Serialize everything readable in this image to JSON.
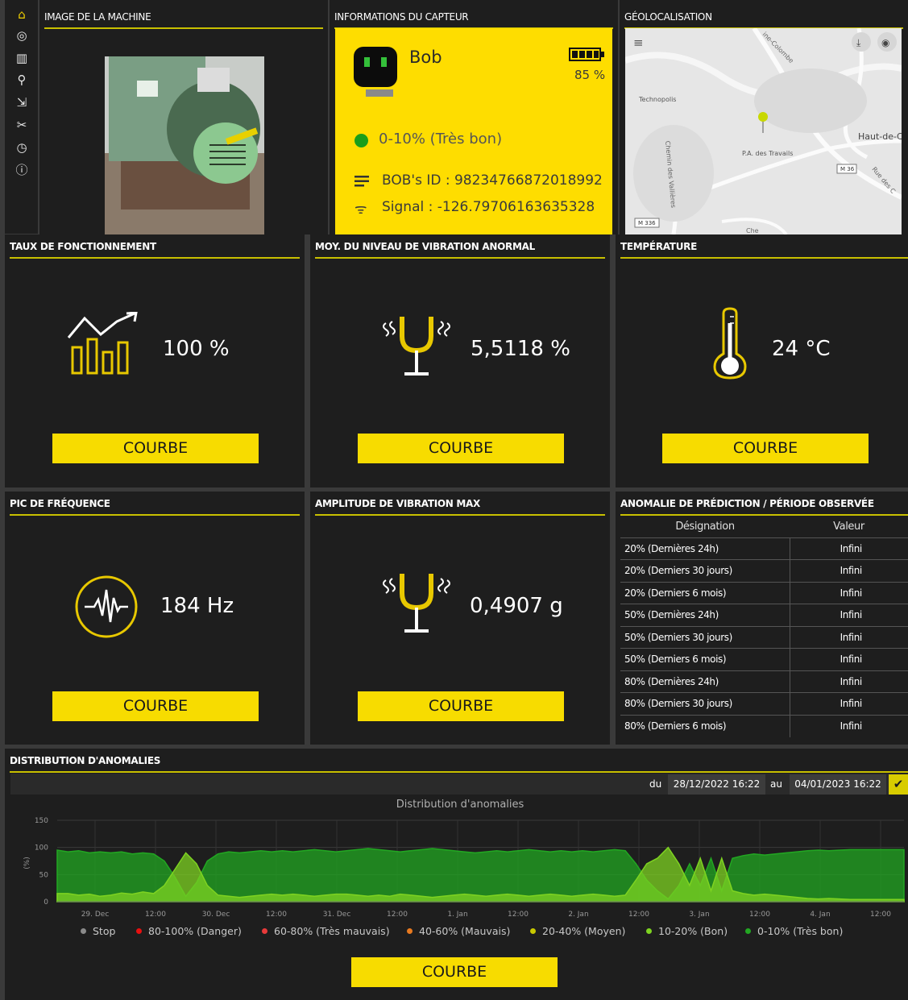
{
  "sidebar": {
    "icons": [
      "home-icon",
      "dashboard-icon",
      "analytics-icon",
      "search-icon",
      "export-icon",
      "tools-icon",
      "history-icon",
      "info-icon"
    ]
  },
  "machine_image": {
    "title": "IMAGE DE LA MACHINE"
  },
  "sensor_info": {
    "title": "INFORMATIONS DU CAPTEUR",
    "name": "Bob",
    "battery": "85 %",
    "status": "0-10% (Très bon)",
    "bob_id": "BOB's ID : 98234766872018992",
    "signal": "Signal : -126.79706163635328",
    "status_color": "#1a9e1a"
  },
  "geoloc": {
    "title": "GÉOLOCALISATION",
    "labels": {
      "technopolis": "Technopolis",
      "pa": "P.A. des Travails",
      "haut": "Haut-de-C",
      "colombe": "ine-Colombe",
      "chemin": "Chemin des Vallières",
      "rue": "Rue des C",
      "m36": "M 36",
      "m336": "M 336",
      "che": "Che"
    }
  },
  "metrics": {
    "taux": {
      "title": "TAUX DE FONCTIONNEMENT",
      "value": "100 %",
      "button": "COURBE"
    },
    "moy": {
      "title": "MOY. DU NIVEAU DE VIBRATION ANORMAL",
      "value": "5,5118 %",
      "button": "COURBE"
    },
    "temp": {
      "title": "TEMPÉRATURE",
      "value": "24 °C",
      "button": "COURBE"
    },
    "pic": {
      "title": "PIC DE FRÉQUENCE",
      "value": "184 Hz",
      "button": "COURBE"
    },
    "amp": {
      "title": "AMPLITUDE DE VIBRATION MAX",
      "value": "0,4907 g",
      "button": "COURBE"
    }
  },
  "anomaly_table": {
    "title": "ANOMALIE DE PRÉDICTION / PÉRIODE OBSERVÉE",
    "headers": [
      "Désignation",
      "Valeur"
    ],
    "rows": [
      [
        "20% (Dernières 24h)",
        "Infini"
      ],
      [
        "20% (Derniers 30 jours)",
        "Infini"
      ],
      [
        "20% (Derniers 6 mois)",
        "Infini"
      ],
      [
        "50% (Dernières 24h)",
        "Infini"
      ],
      [
        "50% (Derniers 30 jours)",
        "Infini"
      ],
      [
        "50% (Derniers 6 mois)",
        "Infini"
      ],
      [
        "80% (Dernières 24h)",
        "Infini"
      ],
      [
        "80% (Derniers 30 jours)",
        "Infini"
      ],
      [
        "80% (Derniers 6 mois)",
        "Infini"
      ]
    ]
  },
  "distribution": {
    "title": "DISTRIBUTION D'ANOMALIES",
    "du_label": "du",
    "from": "28/12/2022 16:22",
    "au_label": "au",
    "to": "04/01/2023 16:22",
    "button": "COURBE"
  },
  "chart_data": {
    "type": "area",
    "title": "Distribution d'anomalies",
    "ylabel": "(%)",
    "ylim": [
      0,
      150
    ],
    "yticks": [
      0,
      50,
      100,
      150
    ],
    "xticks": [
      "29. Dec",
      "12:00",
      "30. Dec",
      "12:00",
      "31. Dec",
      "12:00",
      "1. Jan",
      "12:00",
      "2. Jan",
      "12:00",
      "3. Jan",
      "12:00",
      "4. Jan",
      "12:00"
    ],
    "series": [
      {
        "name": "Stop",
        "color": "#8a8a8a",
        "values": []
      },
      {
        "name": "80-100% (Danger)",
        "color": "#e81010",
        "values": []
      },
      {
        "name": "60-80% (Très mauvais)",
        "color": "#e83a3a",
        "values": []
      },
      {
        "name": "40-60% (Mauvais)",
        "color": "#e87a20",
        "values": []
      },
      {
        "name": "20-40% (Moyen)",
        "color": "#c8c800",
        "values": [
          0,
          0,
          0,
          0,
          0,
          0,
          0,
          0,
          0,
          0,
          0,
          0,
          0,
          0,
          0,
          0,
          0,
          0,
          0,
          0,
          0,
          0,
          0,
          0,
          0,
          0,
          0,
          0,
          0,
          0,
          0,
          0,
          0,
          0,
          0,
          0,
          0,
          0,
          0,
          0,
          0,
          0,
          0,
          0,
          0,
          0,
          0,
          0,
          0,
          0,
          0,
          0,
          0,
          0,
          0,
          0,
          0,
          0,
          0,
          0,
          0,
          0,
          0,
          0,
          0,
          0,
          0,
          0,
          0,
          0,
          0,
          0,
          0,
          0,
          0,
          0,
          0,
          0,
          0,
          0
        ]
      },
      {
        "name": "10-20% (Bon)",
        "color": "#7ed321",
        "values": [
          15,
          15,
          12,
          14,
          10,
          12,
          16,
          14,
          18,
          15,
          30,
          60,
          90,
          70,
          30,
          12,
          10,
          8,
          10,
          12,
          14,
          12,
          14,
          12,
          10,
          12,
          14,
          14,
          12,
          10,
          12,
          10,
          14,
          12,
          10,
          8,
          10,
          12,
          14,
          12,
          10,
          12,
          14,
          12,
          10,
          12,
          14,
          12,
          10,
          12,
          14,
          12,
          10,
          12,
          40,
          70,
          80,
          100,
          70,
          30,
          80,
          20,
          80,
          20,
          15,
          12,
          14,
          12,
          10,
          8,
          6,
          5,
          6,
          5,
          4,
          4,
          4,
          4,
          4,
          4
        ]
      },
      {
        "name": "0-10% (Très bon)",
        "color": "#22a722",
        "values": [
          95,
          92,
          94,
          90,
          92,
          90,
          92,
          88,
          90,
          88,
          75,
          45,
          10,
          35,
          75,
          88,
          92,
          90,
          92,
          94,
          92,
          94,
          92,
          94,
          96,
          94,
          92,
          94,
          96,
          98,
          96,
          94,
          92,
          94,
          96,
          98,
          96,
          94,
          92,
          90,
          92,
          94,
          92,
          94,
          96,
          94,
          92,
          94,
          92,
          94,
          92,
          94,
          96,
          94,
          70,
          40,
          20,
          5,
          30,
          70,
          30,
          80,
          20,
          80,
          85,
          88,
          86,
          88,
          90,
          92,
          94,
          95,
          94,
          95,
          96,
          96,
          96,
          96,
          96,
          96
        ]
      }
    ]
  }
}
